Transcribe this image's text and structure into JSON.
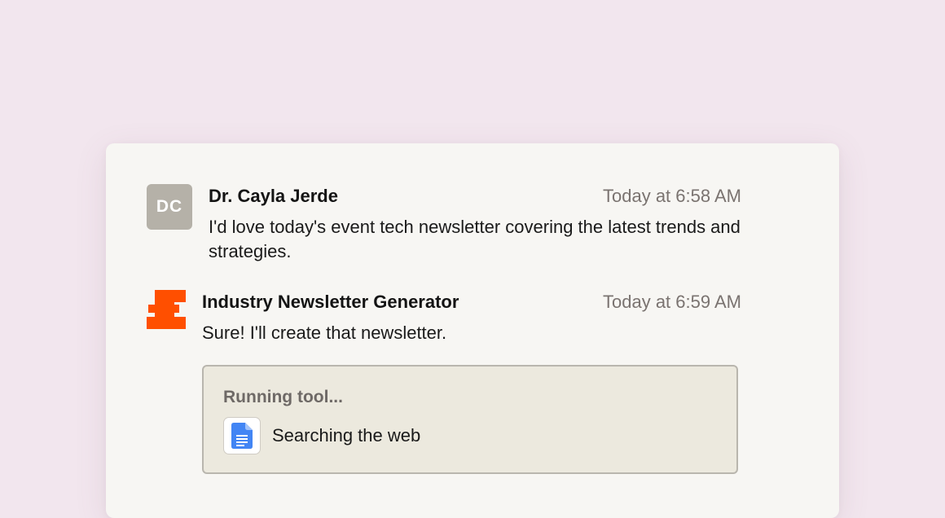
{
  "colors": {
    "page_background": "#f2e6ee",
    "card_background": "#f7f6f3",
    "avatar_background": "#b5b1a8",
    "brand_orange": "#ff4f00",
    "tool_box_background": "#ece9de",
    "doc_icon_blue": "#4285f4"
  },
  "messages": [
    {
      "avatar_initials": "DC",
      "author": "Dr. Cayla Jerde",
      "timestamp": "Today at 6:58 AM",
      "text": "I'd love today's event tech newsletter covering the latest trends and strategies."
    },
    {
      "avatar_icon": "zapier-logo-icon",
      "author": "Industry Newsletter Generator",
      "timestamp": "Today at 6:59 AM",
      "text": "Sure! I'll create that newsletter."
    }
  ],
  "tool": {
    "status": "Running tool...",
    "icon": "google-docs-icon",
    "label": "Searching the web"
  }
}
